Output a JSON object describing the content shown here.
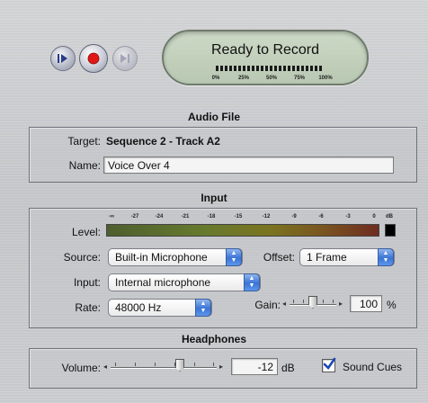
{
  "transport": {
    "buttons": [
      {
        "icon": "play-in-icon",
        "enabled": true
      },
      {
        "icon": "record-icon",
        "enabled": true
      },
      {
        "icon": "play-out-icon",
        "enabled": false
      }
    ]
  },
  "status": {
    "message": "Ready to Record",
    "meter_labels": [
      "0%",
      "25%",
      "50%",
      "75%",
      "100%"
    ],
    "progress_percent": 100
  },
  "audio_file": {
    "title": "Audio File",
    "target_label": "Target:",
    "target_value": "Sequence 2 - Track A2",
    "name_label": "Name:",
    "name_value": "Voice Over 4"
  },
  "input": {
    "title": "Input",
    "level_label": "Level:",
    "level_scale": [
      "-∞",
      "-27",
      "-24",
      "-21",
      "-18",
      "-15",
      "-12",
      "-9",
      "-6",
      "-3",
      "0",
      "dB"
    ],
    "source_label": "Source:",
    "source_value": "Built-in Microphone",
    "offset_label": "Offset:",
    "offset_value": "1 Frame",
    "input_label": "Input:",
    "input_value": "Internal microphone",
    "rate_label": "Rate:",
    "rate_value": "48000 Hz",
    "gain_label": "Gain:",
    "gain_value": "100",
    "gain_unit": "%"
  },
  "headphones": {
    "title": "Headphones",
    "volume_label": "Volume:",
    "volume_value": "-12",
    "volume_unit": "dB",
    "sound_cues_label": "Sound Cues",
    "sound_cues_checked": true
  },
  "colors": {
    "lcd": "#c4d3bd",
    "accent": "#3a74d6",
    "record": "#e01818"
  }
}
